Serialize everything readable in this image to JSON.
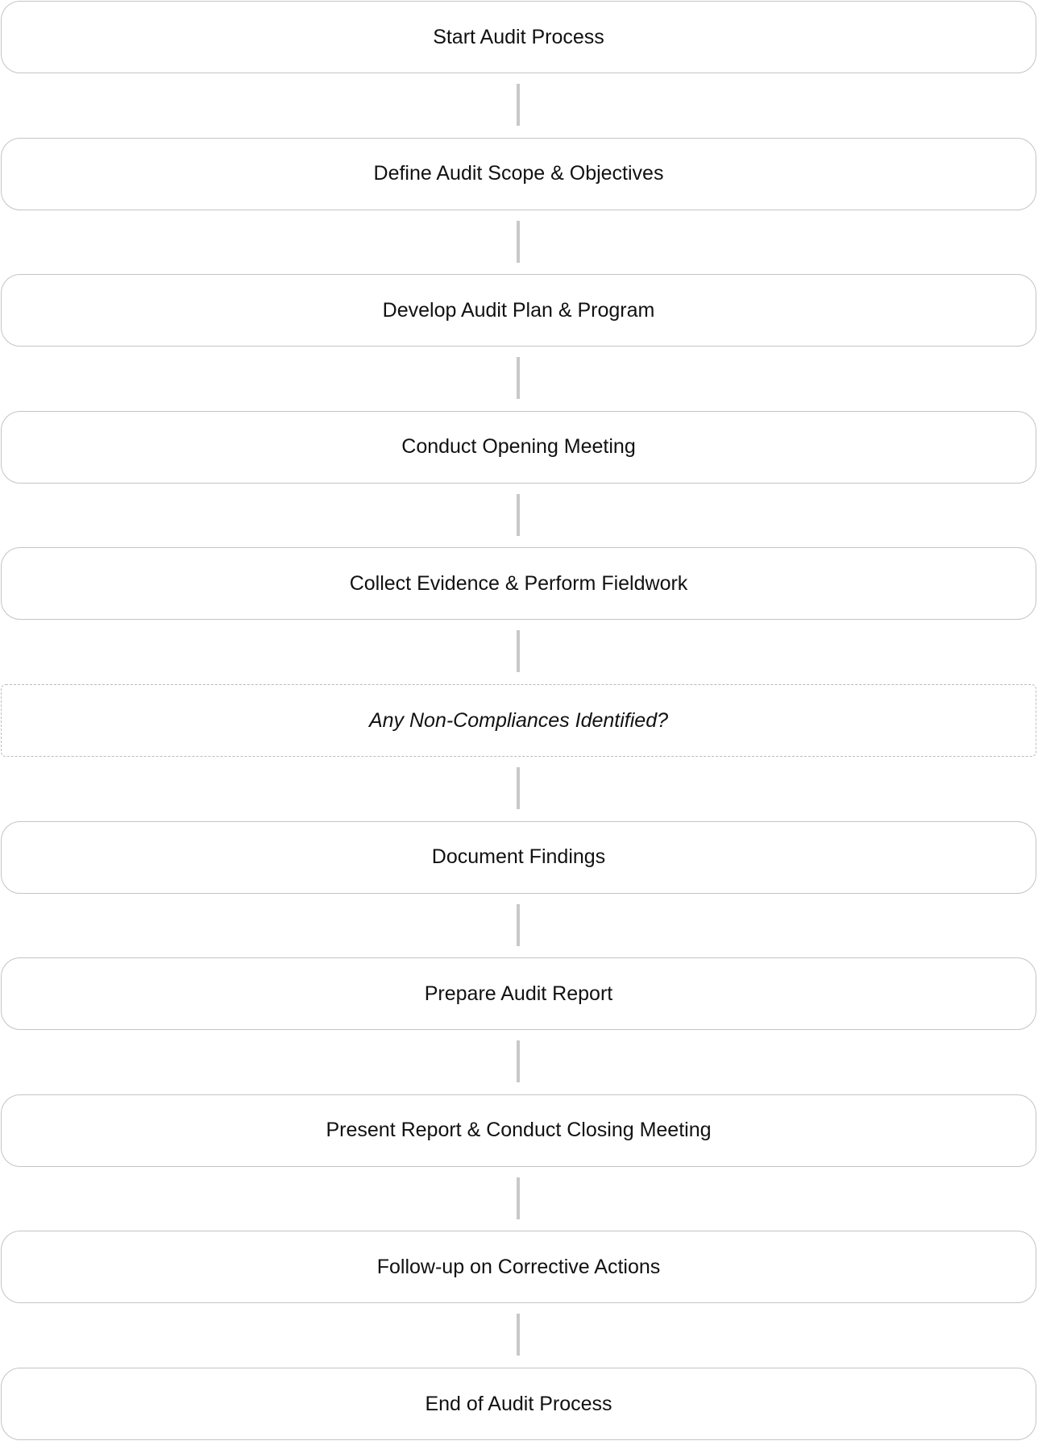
{
  "flowchart": {
    "steps": [
      {
        "label": "Start Audit Process",
        "kind": "process"
      },
      {
        "label": "Define Audit Scope & Objectives",
        "kind": "process"
      },
      {
        "label": "Develop Audit Plan & Program",
        "kind": "process"
      },
      {
        "label": "Conduct Opening Meeting",
        "kind": "process"
      },
      {
        "label": "Collect Evidence & Perform Fieldwork",
        "kind": "process"
      },
      {
        "label": "Any Non-Compliances Identified?",
        "kind": "decision"
      },
      {
        "label": "Document Findings",
        "kind": "process"
      },
      {
        "label": "Prepare Audit Report",
        "kind": "process"
      },
      {
        "label": "Present Report & Conduct Closing Meeting",
        "kind": "process"
      },
      {
        "label": "Follow-up on Corrective Actions",
        "kind": "process"
      },
      {
        "label": "End of Audit Process",
        "kind": "process"
      }
    ],
    "colors": {
      "box_border": "#c4c4c4",
      "decision_border": "#bdbdbd",
      "connector": "#c8c8c8",
      "text": "#111111",
      "background": "#ffffff"
    }
  }
}
